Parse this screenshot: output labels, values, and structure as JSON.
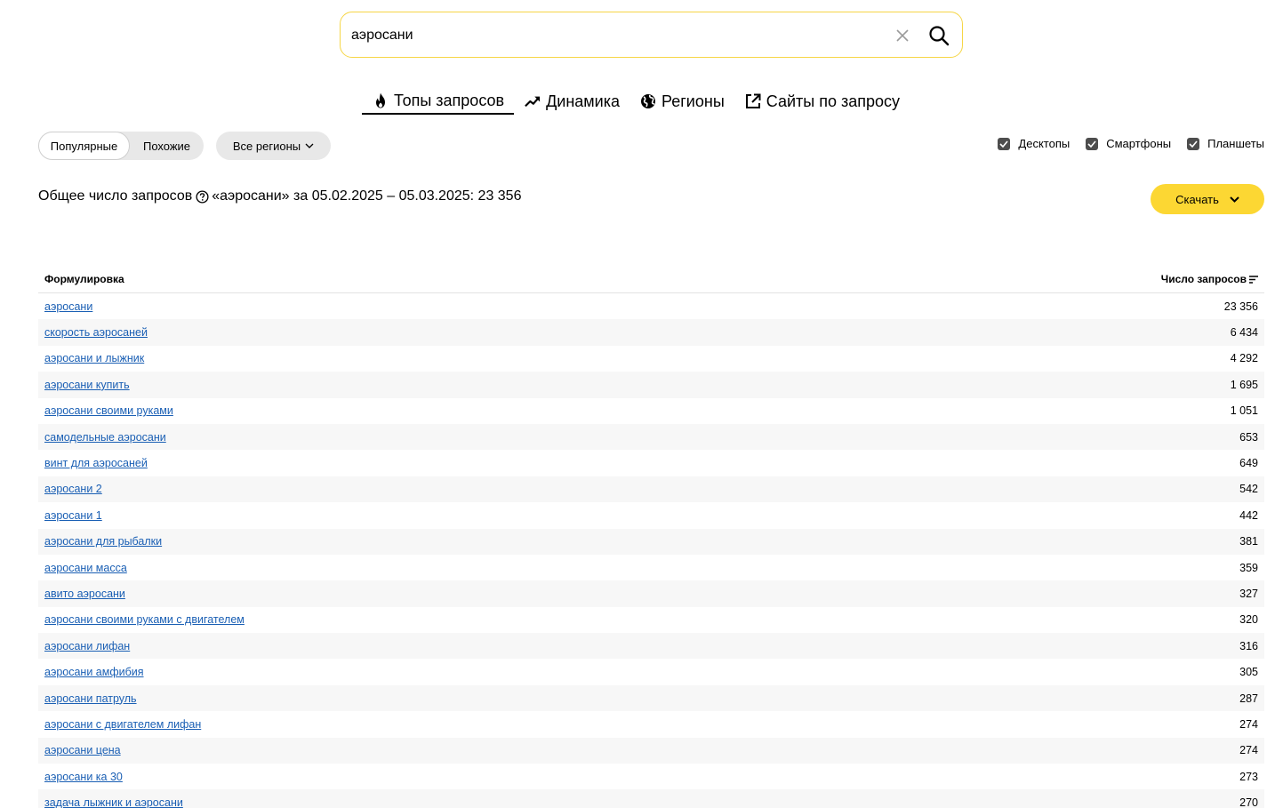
{
  "search": {
    "value": "аэросани"
  },
  "tabs": [
    {
      "label": "Топы запросов",
      "icon": "fire-icon",
      "active": true
    },
    {
      "label": "Динамика",
      "icon": "trend-up-icon",
      "active": false
    },
    {
      "label": "Регионы",
      "icon": "globe-icon",
      "active": false
    },
    {
      "label": "Сайты по запросу",
      "icon": "external-link-icon",
      "active": false
    }
  ],
  "segment": {
    "popular": "Популярные",
    "similar": "Похожие"
  },
  "region_filter": "Все регионы",
  "devices": {
    "desktop": "Десктопы",
    "smartphones": "Смартфоны",
    "tablets": "Планшеты"
  },
  "summary": {
    "prefix": "Общее число запросов",
    "suffix": "«аэросани» за 05.02.2025 – 05.03.2025: 23 356"
  },
  "download_label": "Скачать",
  "table": {
    "col_phrase": "Формулировка",
    "col_count": "Число запросов",
    "rows": [
      {
        "phrase": "аэросани",
        "count": "23 356"
      },
      {
        "phrase": "скорость аэросаней",
        "count": "6 434"
      },
      {
        "phrase": "аэросани и лыжник",
        "count": "4 292"
      },
      {
        "phrase": "аэросани купить",
        "count": "1 695"
      },
      {
        "phrase": "аэросани своими руками",
        "count": "1 051"
      },
      {
        "phrase": "самодельные аэросани",
        "count": "653"
      },
      {
        "phrase": "винт для аэросаней",
        "count": "649"
      },
      {
        "phrase": "аэросани 2",
        "count": "542"
      },
      {
        "phrase": "аэросани 1",
        "count": "442"
      },
      {
        "phrase": "аэросани для рыбалки",
        "count": "381"
      },
      {
        "phrase": "аэросани масса",
        "count": "359"
      },
      {
        "phrase": "авито аэросани",
        "count": "327"
      },
      {
        "phrase": "аэросани своими руками с двигателем",
        "count": "320"
      },
      {
        "phrase": "аэросани лифан",
        "count": "316"
      },
      {
        "phrase": "аэросани амфибия",
        "count": "305"
      },
      {
        "phrase": "аэросани патруль",
        "count": "287"
      },
      {
        "phrase": "аэросани с двигателем лифан",
        "count": "274"
      },
      {
        "phrase": "аэросани цена",
        "count": "274"
      },
      {
        "phrase": "аэросани ка 30",
        "count": "273"
      },
      {
        "phrase": "задача лыжник и аэросани",
        "count": "270"
      }
    ]
  }
}
